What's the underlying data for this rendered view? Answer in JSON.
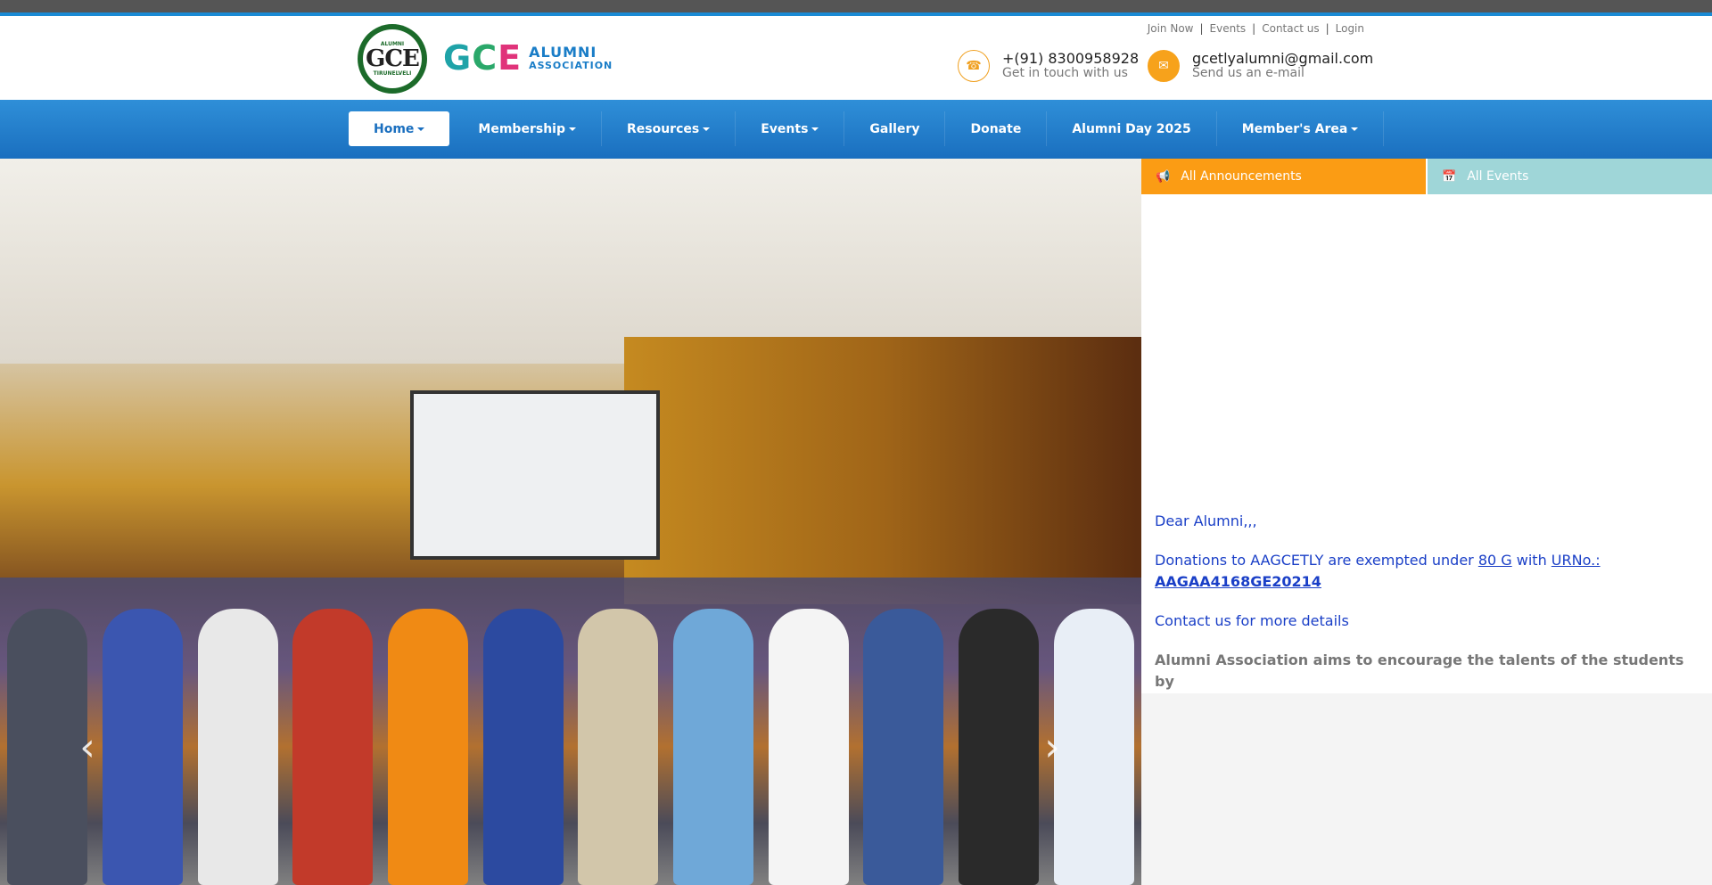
{
  "header": {
    "logo_text": "GCE",
    "logo_small_top": "ALUMNI",
    "logo_small_bottom": "TIRUNELVELI",
    "brand_gce": "GCE",
    "brand_line1": "ALUMNI",
    "brand_line2": "ASSOCIATION",
    "top_links": [
      "Join Now",
      "Events",
      "Contact us",
      "Login"
    ],
    "phone": "+(91) 8300958928",
    "phone_sub": "Get in touch with us",
    "email": "gcetlyalumni@gmail.com",
    "email_sub": "Send us an e-mail"
  },
  "nav": {
    "items": [
      {
        "label": "Home",
        "dropdown": true,
        "active": true
      },
      {
        "label": "Membership",
        "dropdown": true
      },
      {
        "label": "Resources",
        "dropdown": true
      },
      {
        "label": "Events",
        "dropdown": true
      },
      {
        "label": "Gallery",
        "dropdown": false
      },
      {
        "label": "Donate",
        "dropdown": false
      },
      {
        "label": "Alumni Day 2025",
        "dropdown": false
      },
      {
        "label": "Member's Area",
        "dropdown": true
      }
    ]
  },
  "carousel": {
    "prev_icon": "chevron-left-icon",
    "next_icon": "chevron-right-icon"
  },
  "side": {
    "tab_announcements": "All Announcements",
    "tab_events": "All Events",
    "greeting": "Dear Alumni,,,",
    "donation_prefix": "Donations to AAGCETLY are exempted under ",
    "donation_80g": "80 G",
    "donation_with": " with ",
    "donation_urn_label": "URNo.:",
    "donation_urn": " AAGAA4168GE20214",
    "contact_line": "Contact us for more details",
    "aims": "Alumni Association aims to encourage the talents of the students by"
  },
  "colors": {
    "accent": "#1a6fbf",
    "orange": "#fb9c14",
    "cyan": "#9fd6d8",
    "link_blue": "#1a3fc7"
  }
}
